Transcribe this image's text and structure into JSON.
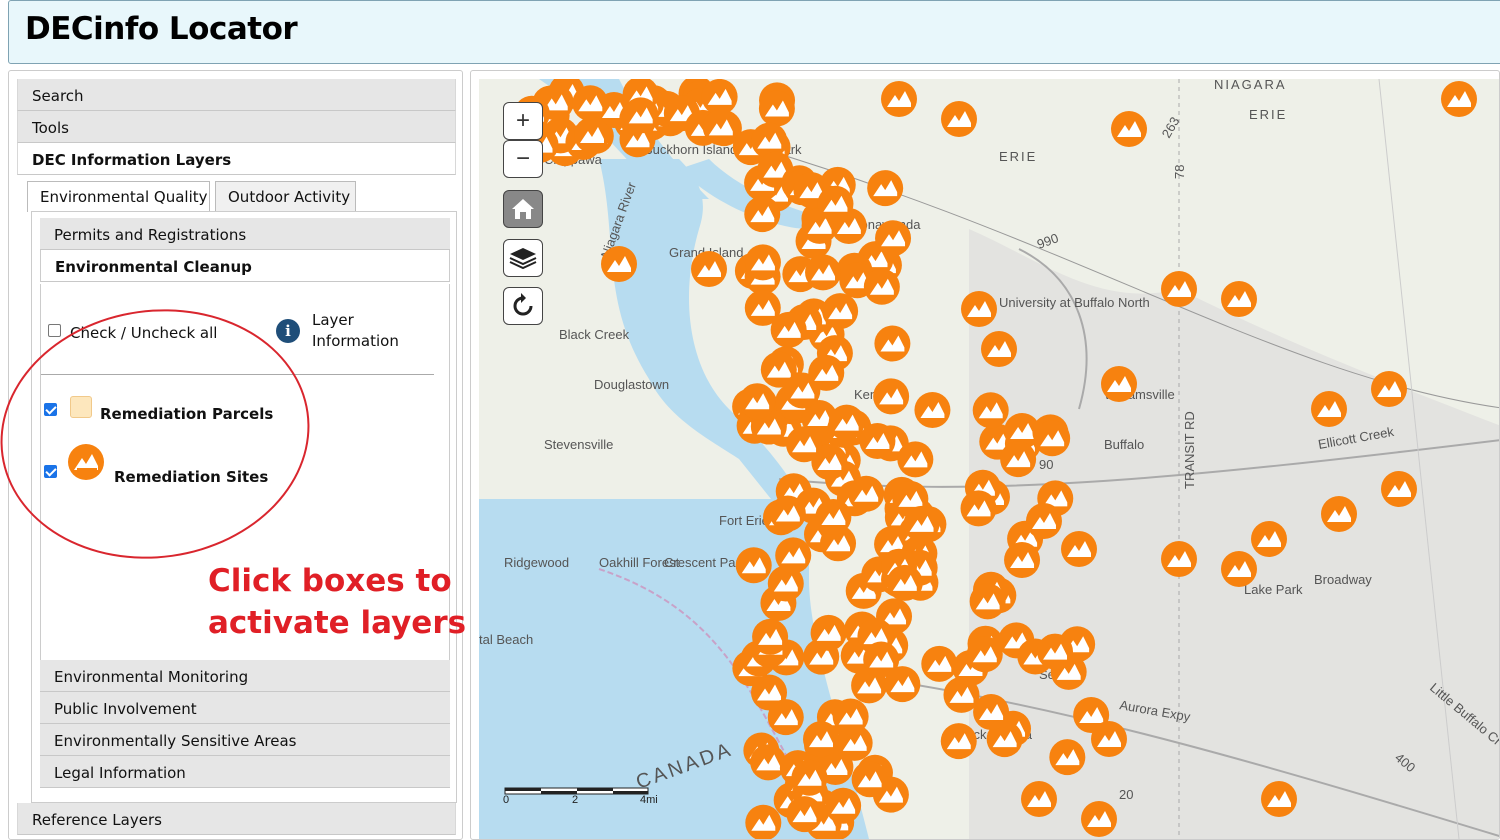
{
  "app": {
    "title": "DECinfo Locator"
  },
  "sidebar": {
    "sections": [
      {
        "label": "Search"
      },
      {
        "label": "Tools"
      },
      {
        "label": "DEC Information Layers"
      }
    ],
    "reference_label": "Reference Layers",
    "tabs": [
      {
        "label": "Environmental Quality"
      },
      {
        "label": "Outdoor Activity"
      }
    ],
    "subsections_top": [
      {
        "label": "Permits and Registrations"
      },
      {
        "label": "Environmental Cleanup"
      }
    ],
    "subsections_bottom": [
      {
        "label": "Environmental Monitoring"
      },
      {
        "label": "Public Involvement"
      },
      {
        "label": "Environmentally Sensitive Areas"
      },
      {
        "label": "Legal Information"
      }
    ],
    "check_all_label": "Check / Uncheck all",
    "layer_info_label": "Layer Information",
    "layers": [
      {
        "label": "Remediation Parcels",
        "checked": true
      },
      {
        "label": "Remediation Sites",
        "checked": true
      }
    ],
    "annotation": {
      "line1": "Click boxes to",
      "line2": "activate layers",
      "color": "#e01f26"
    }
  },
  "map": {
    "zoom_in": "+",
    "zoom_out": "−",
    "place_labels": [
      {
        "text": "Chippawa"
      },
      {
        "text": "Buckhorn Island State Park"
      },
      {
        "text": "Niagara River"
      },
      {
        "text": "Grand Island"
      },
      {
        "text": "Black Creek"
      },
      {
        "text": "Douglastown"
      },
      {
        "text": "Stevensville"
      },
      {
        "text": "Fort Erie"
      },
      {
        "text": "Ridgewood"
      },
      {
        "text": "Oakhill Forest"
      },
      {
        "text": "Crescent Park"
      },
      {
        "text": "tal Beach"
      },
      {
        "text": "CANADA"
      },
      {
        "text": "NIAGARA"
      },
      {
        "text": "ERIE"
      },
      {
        "text": "ERIE"
      },
      {
        "text": "Tonawanda"
      },
      {
        "text": "University at Buffalo North"
      },
      {
        "text": "Williamsville"
      },
      {
        "text": "Kenmore"
      },
      {
        "text": "Buffalo"
      },
      {
        "text": "Ellicott Creek"
      },
      {
        "text": "Lake Park"
      },
      {
        "text": "Broadway"
      },
      {
        "text": "Seneca"
      },
      {
        "text": "Aurora Expy"
      },
      {
        "text": "Lackawanna"
      },
      {
        "text": "Little Buffalo Cr"
      },
      {
        "text": "990"
      },
      {
        "text": "90"
      },
      {
        "text": "78"
      },
      {
        "text": "263"
      },
      {
        "text": "400"
      },
      {
        "text": "20"
      },
      {
        "text": "TRANSIT RD"
      }
    ],
    "scale": {
      "ticks": [
        "0",
        "2",
        "4mi"
      ]
    },
    "marker_color": "#f7820f",
    "water_color": "#b7dcf0"
  }
}
